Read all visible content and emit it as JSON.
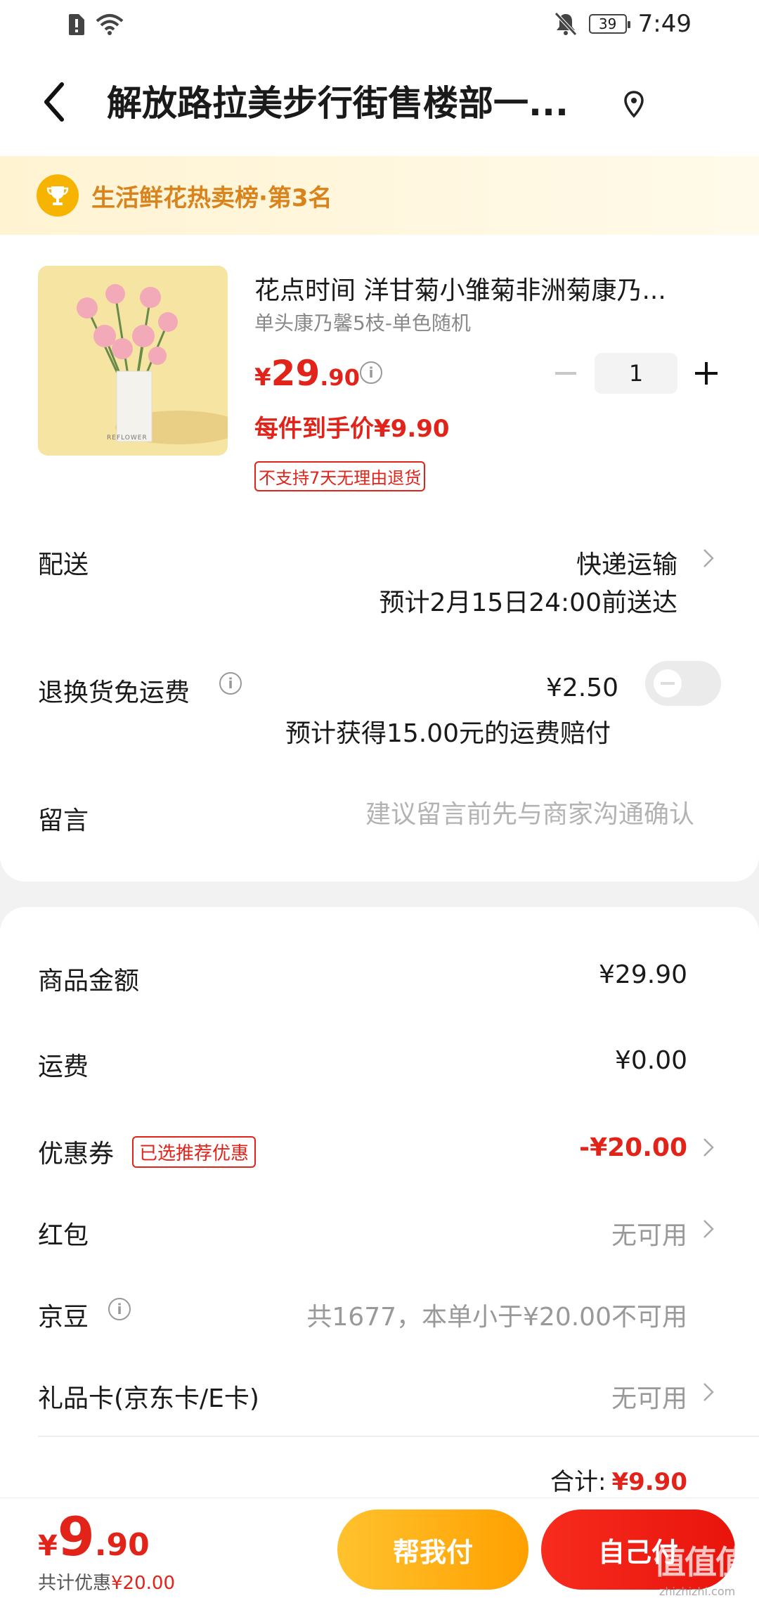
{
  "status_bar": {
    "time": "7:49",
    "battery": "39"
  },
  "nav": {
    "title": "解放路拉美步行街售楼部一..."
  },
  "rank_banner": {
    "text": "生活鲜花热卖榜·第3名"
  },
  "product": {
    "name": "花点时间 洋甘菊小雏菊非洲菊康乃...",
    "spec": "单头康乃馨5枝-单色随机",
    "price_yen": "¥",
    "price_int": "29",
    "price_dec": ".90",
    "quantity": "1",
    "per_price": "每件到手价¥9.90",
    "return_notice": "不支持7天无理由退货",
    "image_text": "REFLOWER"
  },
  "delivery": {
    "label": "配送",
    "method": "快递运输",
    "eta": "预计2月15日24:00前送达"
  },
  "return_shipping": {
    "label": "退换货免运费",
    "price": "¥2.50",
    "compensation": "预计获得15.00元的运费赔付",
    "enabled": false
  },
  "message": {
    "label": "留言",
    "placeholder": "建议留言前先与商家沟通确认"
  },
  "summary": {
    "goods_label": "商品金额",
    "goods_value": "¥29.90",
    "freight_label": "运费",
    "freight_value": "¥0.00",
    "coupon_label": "优惠券",
    "coupon_tag": "已选推荐优惠",
    "coupon_value": "-¥20.00",
    "redpacket_label": "红包",
    "redpacket_value": "无可用",
    "jingdou_label": "京豆",
    "jingdou_value": "共1677，本单小于¥20.00不可用",
    "giftcard_label": "礼品卡(京东卡/E卡)",
    "giftcard_value": "无可用",
    "total_label": "合计:",
    "total_value": "¥9.90"
  },
  "bottom_bar": {
    "yen": "¥",
    "int": "9",
    "dec": ".90",
    "saved_label": "共计优惠",
    "saved_value": "¥20.00",
    "help_pay": "帮我付",
    "self_pay": "自己付"
  },
  "watermark": {
    "main": "值值值",
    "sub": "zhizhizhi.com"
  },
  "colors": {
    "accent_red": "#e2231a",
    "banner_gold": "#d9831d",
    "help_button": "#ffb000"
  }
}
